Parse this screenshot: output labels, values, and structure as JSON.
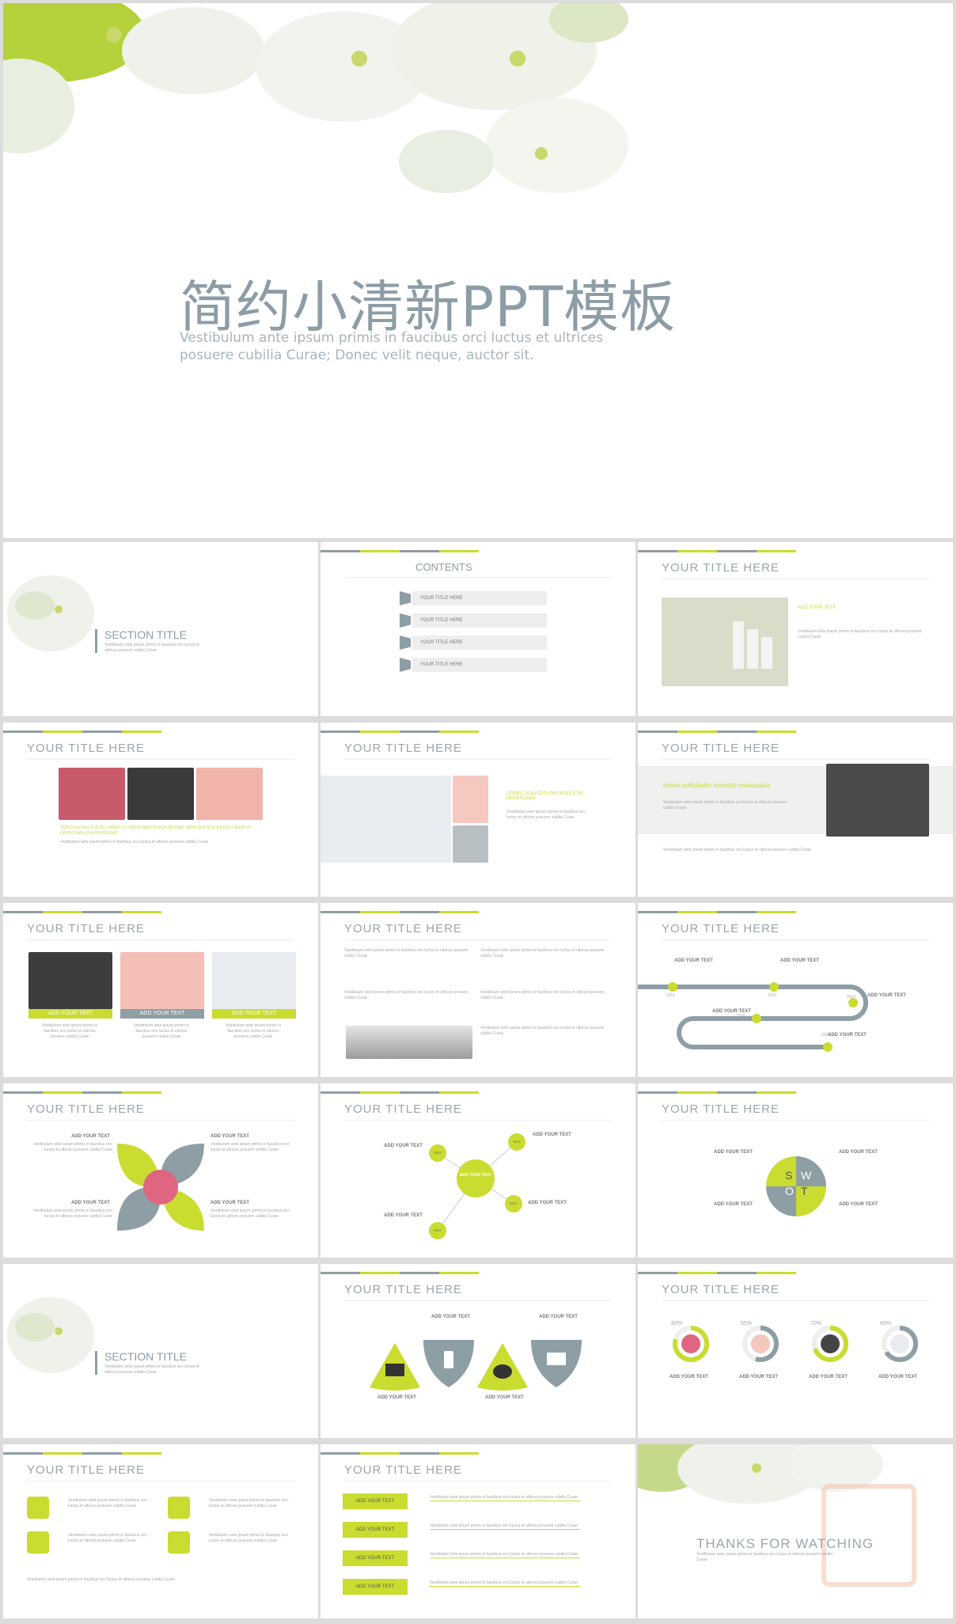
{
  "hero": {
    "title": "简约小清新PPT模板",
    "subtitle_line1": "Vestibulum ante ipsum primis in faucibus orci luctus et ultrices",
    "subtitle_line2": "posuere cubilia Curae; Donec velit neque, auctor sit."
  },
  "common": {
    "slide_title": "YOUR TITLE HERE",
    "add_text": "ADD YOUR TEXT",
    "filler": "Vestibulum ante ipsum primis in faucibus orci luctus et ultrices posuere cubilia Curae"
  },
  "section": {
    "title": "SECTION TITLE"
  },
  "contents": {
    "title": "CONTENTS",
    "items": [
      "YOUR TITLE HERE",
      "YOUR TITLE HERE",
      "YOUR TITLE HERE",
      "YOUR TITLE HERE"
    ]
  },
  "slide_products": {
    "heading": "ADD YOUR TEXT"
  },
  "slide_makeup": {
    "heading": "VEHICULA NULLA QUIS LOREM UT LIBERO MALESUADA FEUGIAT VEHICULA NULLA QUIS LOREM UT LIBERO MALESUADA FEUGIAT"
  },
  "slide_bottles": {
    "heading": "DONEC SOLLICITUDIN MOLESTIE MALESUADA"
  },
  "slide_banner": {
    "heading": "donec sollicitudin molestie malesuada"
  },
  "timeline": {
    "years": [
      "2011",
      "2012",
      "2013",
      "2014",
      "2015"
    ]
  },
  "network": {
    "center": "ADD YOUR TEXT",
    "nodes": [
      "TEXT",
      "TEXT",
      "TEXT",
      "TEXT"
    ]
  },
  "swot": {
    "letters": [
      "S",
      "W",
      "O",
      "T"
    ]
  },
  "progress": {
    "values": [
      "80%",
      "55%",
      "70%",
      "66%"
    ]
  },
  "buttons": {
    "labels": [
      "ADD YOUR TEXT",
      "ADD YOUR TEXT",
      "ADD YOUR TEXT",
      "ADD YOUR TEXT"
    ]
  },
  "thanks": {
    "title": "THANKS FOR WATCHING"
  },
  "colors": {
    "lime": "#c9dc2f",
    "grey": "#8e9ea5",
    "title": "#8d9da5"
  }
}
